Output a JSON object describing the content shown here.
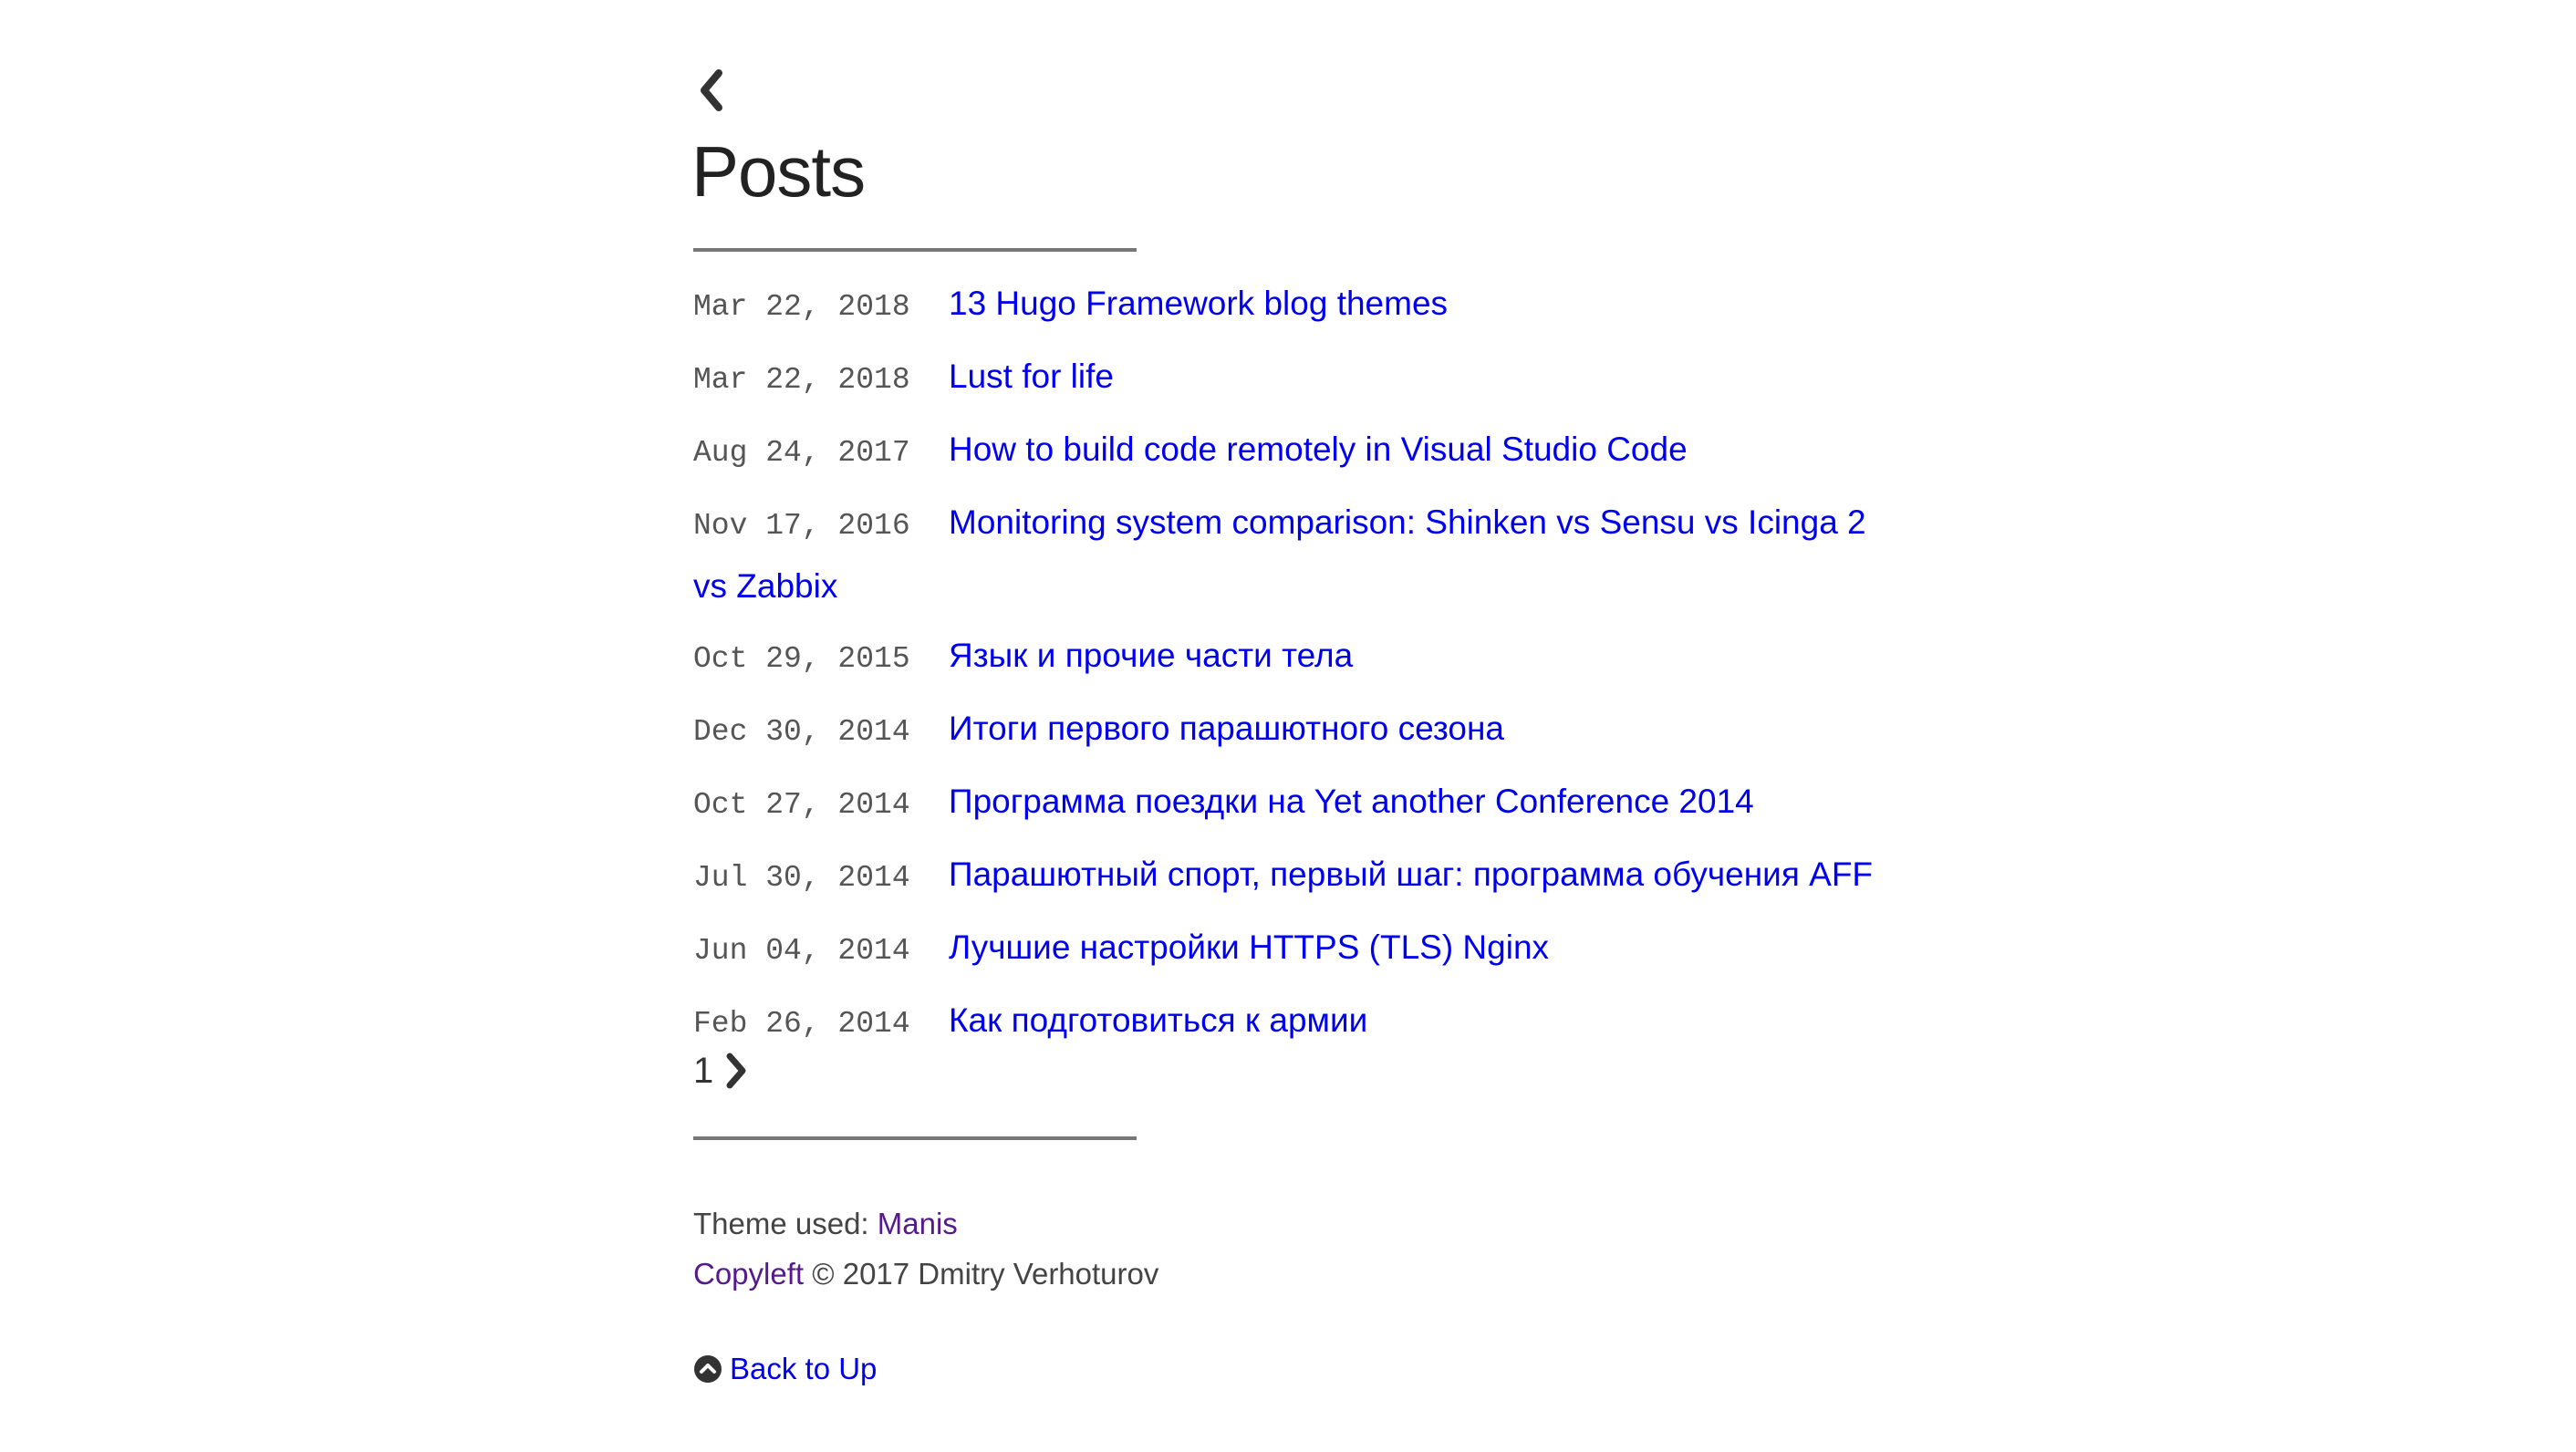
{
  "header": {
    "back_icon": "chevron-left-icon",
    "title": "Posts"
  },
  "posts": [
    {
      "date": "Mar 22, 2018",
      "title": "13 Hugo Framework blog themes"
    },
    {
      "date": "Mar 22, 2018",
      "title": "Lust for life"
    },
    {
      "date": "Aug 24, 2017",
      "title": "How to build code remotely in Visual Studio Code"
    },
    {
      "date": "Nov 17, 2016",
      "title": "Monitoring system comparison: Shinken vs Sensu vs Icinga 2 vs Zabbix"
    },
    {
      "date": "Oct 29, 2015",
      "title": "Язык и прочие части тела"
    },
    {
      "date": "Dec 30, 2014",
      "title": "Итоги первого парашютного сезона"
    },
    {
      "date": "Oct 27, 2014",
      "title": "Программа поездки на Yet another Conference 2014"
    },
    {
      "date": "Jul 30, 2014",
      "title": "Парашютный спорт, первый шаг: программа обучения AFF"
    },
    {
      "date": "Jun 04, 2014",
      "title": "Лучшие настройки HTTPS (TLS) Nginx"
    },
    {
      "date": "Feb 26, 2014",
      "title": "Как подготовиться к армии"
    }
  ],
  "pagination": {
    "current_page": "1",
    "next_icon": "chevron-right-icon"
  },
  "footer": {
    "theme_prefix": "Theme used: ",
    "theme_link": "Manis",
    "copyleft_link": "Copyleft",
    "copyright_text": " © 2017 Dmitry Verhoturov",
    "back_to_up_icon": "chevron-circle-up-icon",
    "back_to_up_label": "Back to Up"
  },
  "colors": {
    "link": "#0000ee",
    "visited_link": "#551a8b",
    "text": "#333333",
    "date": "#555555",
    "rule": "#777777"
  }
}
